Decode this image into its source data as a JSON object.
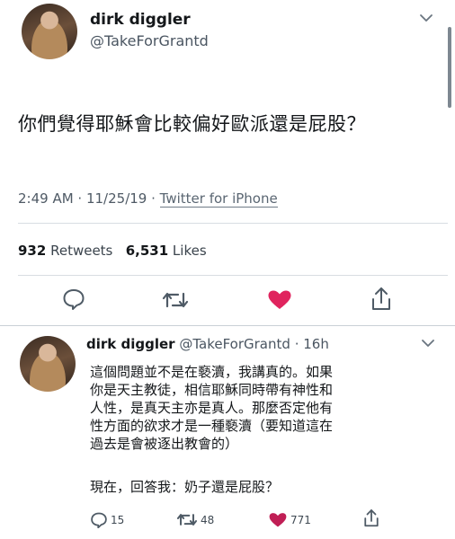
{
  "main_tweet": {
    "author_name": "dirk diggler",
    "author_handle": "@TakeForGrantd",
    "text": "你們覺得耶穌會比較偏好歐派還是屁股？",
    "time": "2:49 AM",
    "date": "11/25/19",
    "separator1": " · ",
    "separator2": " · ",
    "source": "Twitter for iPhone",
    "retweets_count": "932",
    "retweets_label": "Retweets",
    "likes_count": "6,531",
    "likes_label": "Likes",
    "icons": [
      "comment-icon",
      "retweet-icon",
      "heart-icon",
      "share-icon"
    ],
    "liked_color": "#e0245e"
  },
  "reply": {
    "author_name": "dirk diggler",
    "author_handle": "@TakeForGrantd",
    "dot": " · ",
    "age": "16h",
    "lines": [
      "這個問題並不是在褻瀆，我講真的。如果",
      "你是天主教徒，相信耶穌同時帶有神性和",
      "人性，是真天主亦是真人。那麼否定他有",
      "性方面的欲求才是一種褻瀆（要知道這在",
      "過去是會被逐出教會的）"
    ],
    "question": "現在，回答我：奶子還是屁股？",
    "reply_count": "15",
    "retweet_count": "48",
    "like_count": "771"
  }
}
